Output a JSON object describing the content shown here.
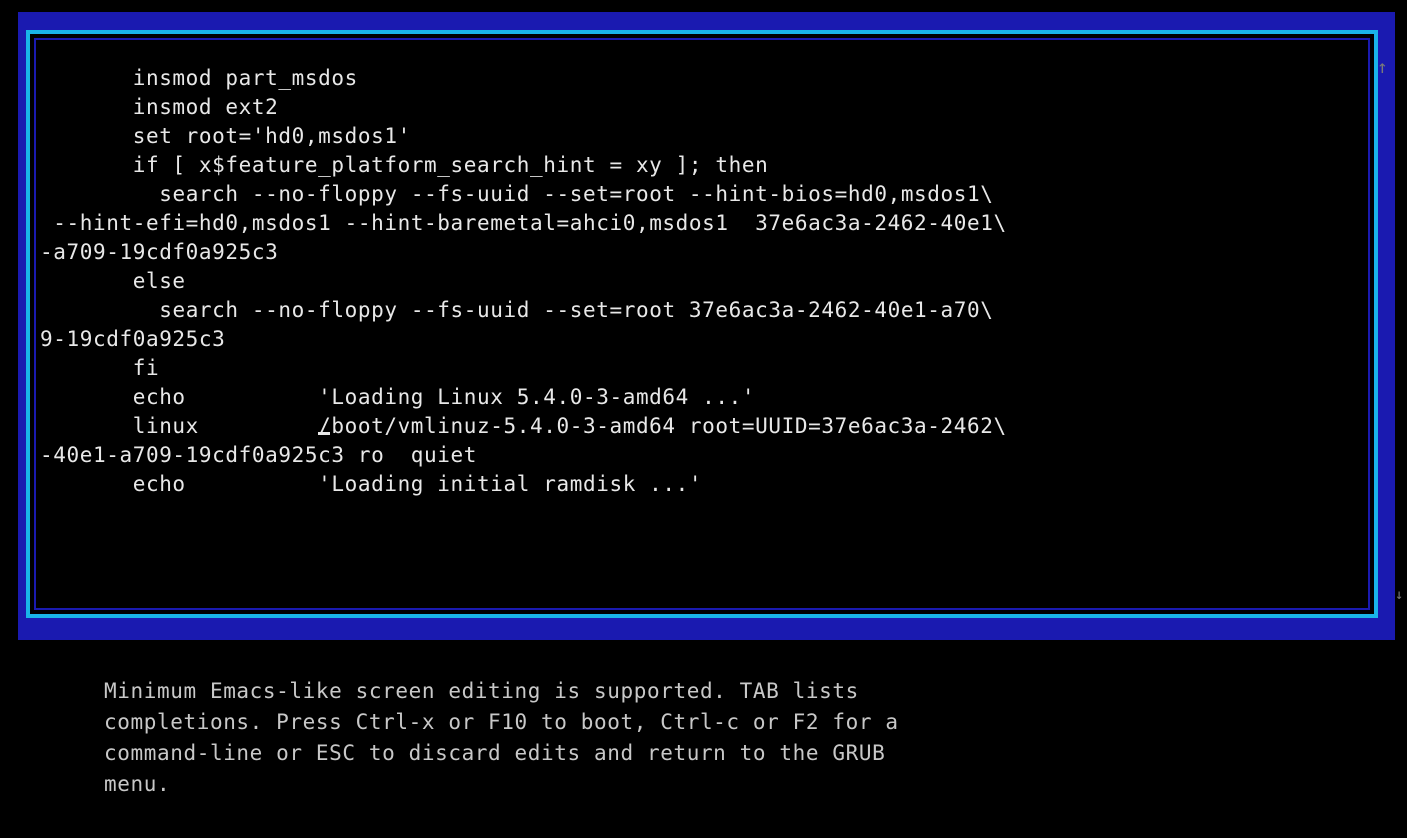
{
  "window": {
    "title": "",
    "colors": {
      "background": "#000000",
      "band": "#1a1ab0",
      "frame_border": "#19b4e8",
      "text": "#e8e8e8",
      "help_text": "#c8c8c8"
    }
  },
  "editor": {
    "lines": [
      {
        "indent": "       ",
        "text": "insmod part_msdos"
      },
      {
        "indent": "       ",
        "text": "insmod ext2"
      },
      {
        "indent": "       ",
        "text": "set root='hd0,msdos1'"
      },
      {
        "indent": "       ",
        "text": "if [ x$feature_platform_search_hint = xy ]; then"
      },
      {
        "indent": "         ",
        "text": "search --no-floppy --fs-uuid --set=root --hint-bios=hd0,msdos1\\"
      },
      {
        "indent": " ",
        "text": "--hint-efi=hd0,msdos1 --hint-baremetal=ahci0,msdos1  37e6ac3a-2462-40e1\\"
      },
      {
        "indent": "",
        "text": "-a709-19cdf0a925c3"
      },
      {
        "indent": "       ",
        "text": "else"
      },
      {
        "indent": "         ",
        "text": "search --no-floppy --fs-uuid --set=root 37e6ac3a-2462-40e1-a70\\"
      },
      {
        "indent": "",
        "text": "9-19cdf0a925c3"
      },
      {
        "indent": "       ",
        "text": "fi"
      },
      {
        "indent": "       ",
        "text": "echo          'Loading Linux 5.4.0-3-amd64 ...'"
      },
      {
        "indent": "       ",
        "text": "linux         /boot/vmlinuz-5.4.0-3-amd64 root=UUID=37e6ac3a-2462\\"
      },
      {
        "indent": "",
        "text": "-40e1-a709-19cdf0a925c3 ro  quiet"
      },
      {
        "indent": "       ",
        "text": "echo          'Loading initial ramdisk ...'"
      }
    ],
    "scroll_up_marker": "↑",
    "scroll_down_marker": "↓"
  },
  "help": {
    "lines": [
      "Minimum Emacs-like screen editing is supported. TAB lists",
      "completions. Press Ctrl-x or F10 to boot, Ctrl-c or F2 for a",
      "command-line or ESC to discard edits and return to the GRUB",
      "menu."
    ]
  }
}
